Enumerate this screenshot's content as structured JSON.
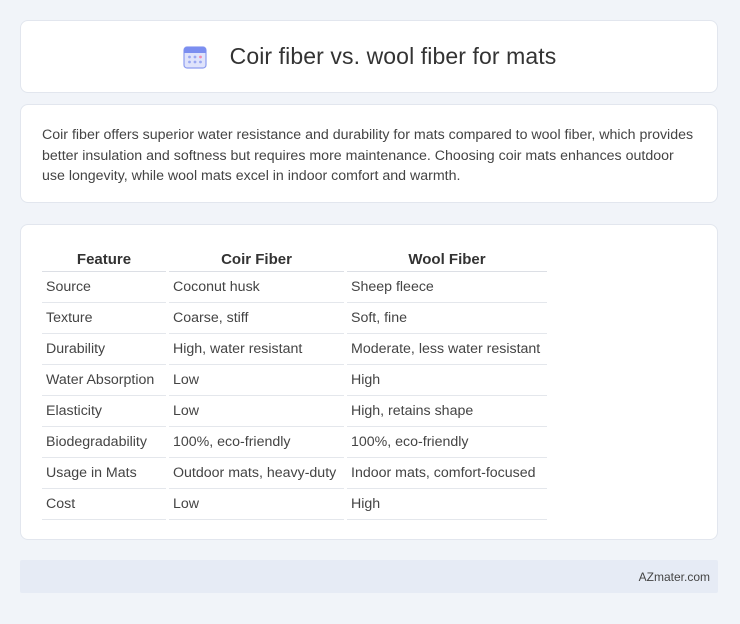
{
  "header": {
    "title": "Coir fiber vs. wool fiber for mats",
    "icon": "calendar-icon"
  },
  "summary": {
    "text": "Coir fiber offers superior water resistance and durability for mats compared to wool fiber, which provides better insulation and softness but requires more maintenance. Choosing coir mats enhances outdoor use longevity, while wool mats excel in indoor comfort and warmth."
  },
  "table": {
    "headers": [
      "Feature",
      "Coir Fiber",
      "Wool Fiber"
    ],
    "rows": [
      [
        "Source",
        "Coconut husk",
        "Sheep fleece"
      ],
      [
        "Texture",
        "Coarse, stiff",
        "Soft, fine"
      ],
      [
        "Durability",
        "High, water resistant",
        "Moderate, less water resistant"
      ],
      [
        "Water Absorption",
        "Low",
        "High"
      ],
      [
        "Elasticity",
        "Low",
        "High, retains shape"
      ],
      [
        "Biodegradability",
        "100%, eco-friendly",
        "100%, eco-friendly"
      ],
      [
        "Usage in Mats",
        "Outdoor mats, heavy-duty",
        "Indoor mats, comfort-focused"
      ],
      [
        "Cost",
        "Low",
        "High"
      ]
    ]
  },
  "footer": {
    "text": "AZmater.com"
  },
  "colors": {
    "background": "#f1f4f9",
    "card": "#ffffff",
    "footer": "#e6ebf5",
    "icon_primary": "#7b8ef0",
    "icon_accent": "#f28bb0"
  }
}
